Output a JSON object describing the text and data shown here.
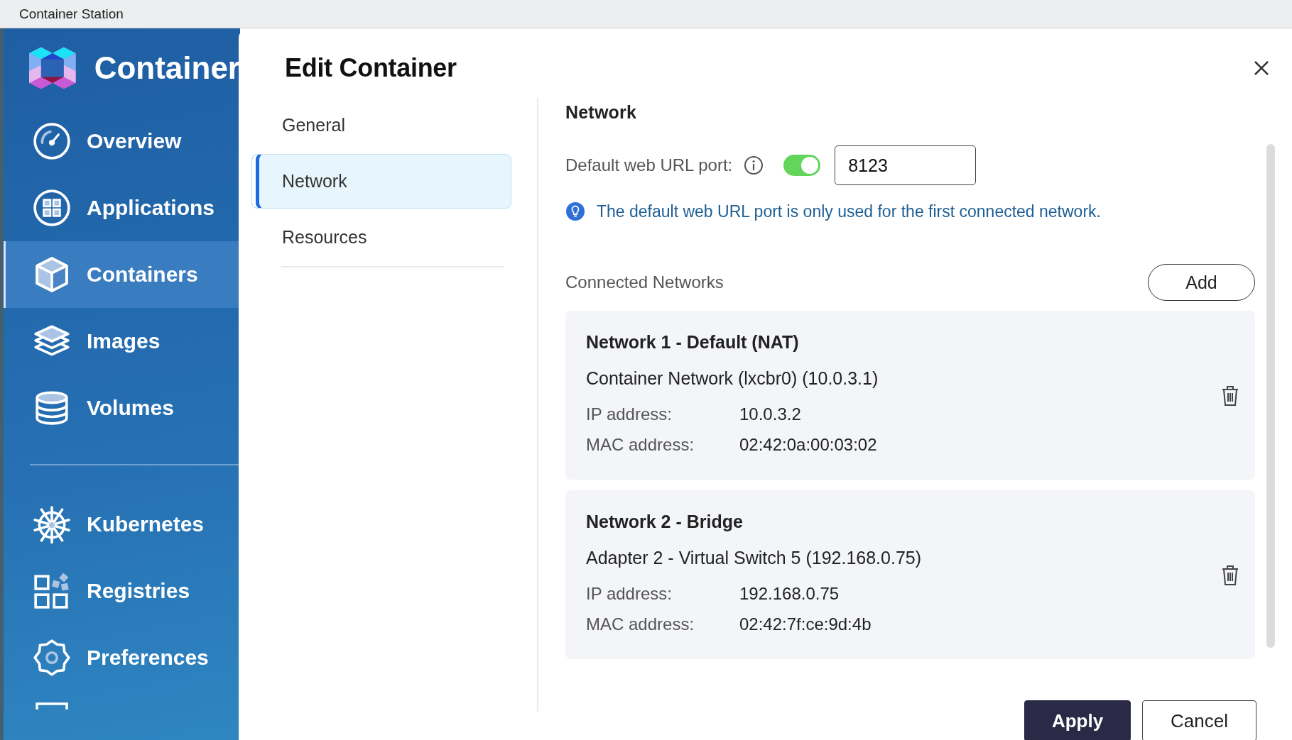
{
  "window": {
    "title": "Container Station"
  },
  "sidebar": {
    "app_name": "Container",
    "items": [
      {
        "label": "Overview",
        "kind": "gauge",
        "selected": false
      },
      {
        "label": "Applications",
        "kind": "apps",
        "selected": false
      },
      {
        "label": "Containers",
        "kind": "cube",
        "selected": true
      },
      {
        "label": "Images",
        "kind": "layers",
        "selected": false
      },
      {
        "label": "Volumes",
        "kind": "database",
        "selected": false
      },
      {
        "label": "Kubernetes",
        "kind": "wheel",
        "selected": false
      },
      {
        "label": "Registries",
        "kind": "registry",
        "selected": false
      },
      {
        "label": "Preferences",
        "kind": "gear",
        "selected": false
      }
    ]
  },
  "dialog": {
    "title": "Edit Container",
    "tabs": [
      {
        "label": "General",
        "selected": false
      },
      {
        "label": "Network",
        "selected": true
      },
      {
        "label": "Resources",
        "selected": false
      }
    ],
    "section_title": "Network",
    "port": {
      "label": "Default web URL port:",
      "on": true,
      "value": "8123"
    },
    "hint": "The default web URL port is only used for the first connected network.",
    "connected_title": "Connected Networks",
    "add_button": "Add",
    "networks": [
      {
        "title": "Network 1 - Default (NAT)",
        "adapter": "Container Network (lxcbr0) (10.0.3.1)",
        "fields": [
          {
            "label": "IP address:",
            "value": "10.0.3.2"
          },
          {
            "label": "MAC address:",
            "value": "02:42:0a:00:03:02"
          }
        ]
      },
      {
        "title": "Network 2 - Bridge",
        "adapter": "Adapter 2 - Virtual Switch 5 (192.168.0.75)",
        "fields": [
          {
            "label": "IP address:",
            "value": "192.168.0.75"
          },
          {
            "label": "MAC address:",
            "value": "02:42:7f:ce:9d:4b"
          }
        ]
      }
    ],
    "buttons": [
      {
        "label": "Apply",
        "kind": "primary"
      },
      {
        "label": "Cancel",
        "kind": "secondary"
      }
    ]
  }
}
